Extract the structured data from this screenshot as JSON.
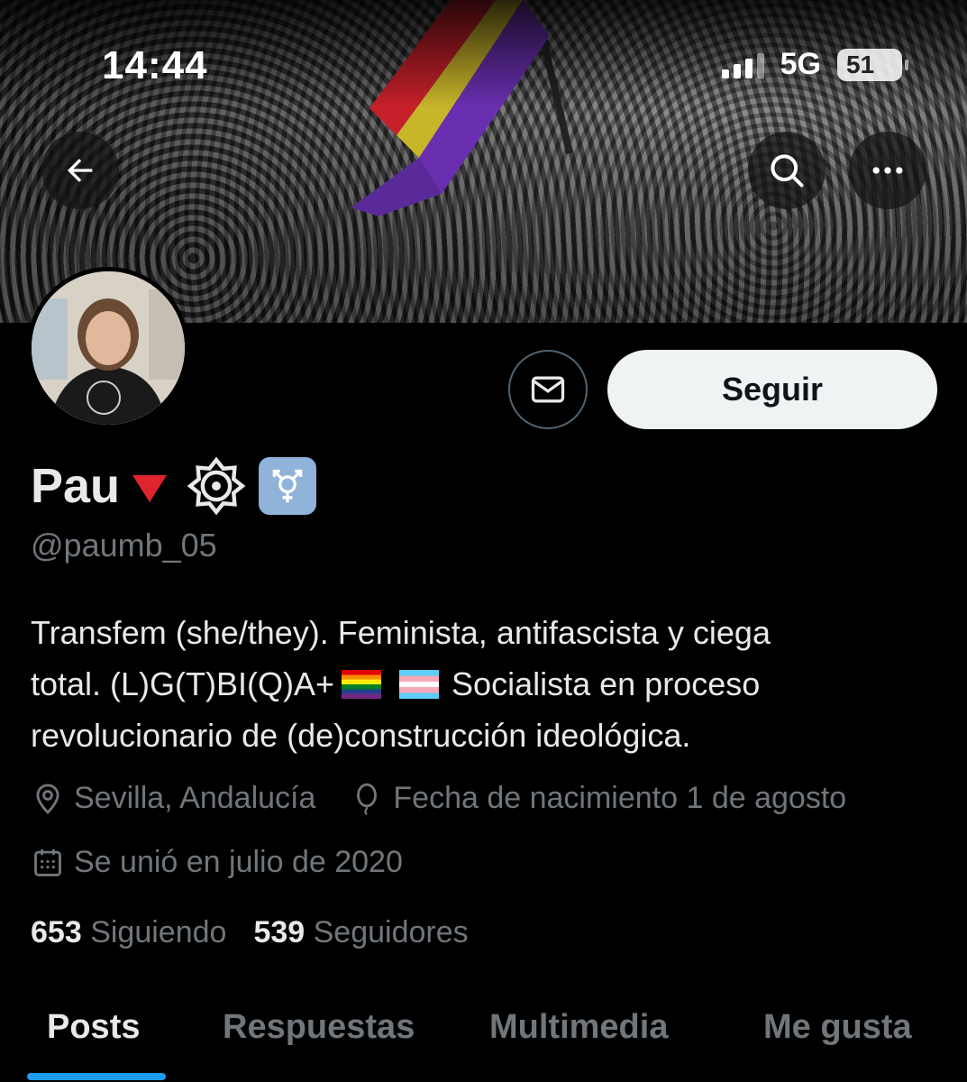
{
  "status_bar": {
    "time": "14:44",
    "network": "5G",
    "battery": "51"
  },
  "profile": {
    "name": "Pau",
    "handle": "@paumb_05",
    "bio_line1": "Transfem (she/they). Feminista, antifascista y ciega",
    "bio_line2_a": "total. (L)G(T)BI(Q)A+",
    "bio_line2_b": "Socialista en proceso",
    "bio_line3": "revolucionario de (de)construcción ideológica.",
    "location": "Sevilla, Andalucía",
    "birthday": "Fecha de nacimiento 1 de agosto",
    "joined": "Se unió en julio de 2020",
    "following_count": "653",
    "following_label": "Siguiendo",
    "followers_count": "539",
    "followers_label": "Seguidores"
  },
  "actions": {
    "follow_label": "Seguir"
  },
  "tabs": [
    {
      "label": "Posts",
      "active": true
    },
    {
      "label": "Respuestas",
      "active": false
    },
    {
      "label": "Multimedia",
      "active": false
    },
    {
      "label": "Me gusta",
      "active": false
    }
  ],
  "icons": {
    "back": "arrow-left-icon",
    "search": "search-icon",
    "more": "more-horizontal-icon",
    "message": "envelope-icon",
    "location": "location-pin-icon",
    "birthday": "balloon-icon",
    "joined": "calendar-icon"
  },
  "colors": {
    "accent": "#1d9bf0",
    "muted": "#71767b",
    "text": "#e7e9ea",
    "follow_bg": "#eff3f4"
  }
}
